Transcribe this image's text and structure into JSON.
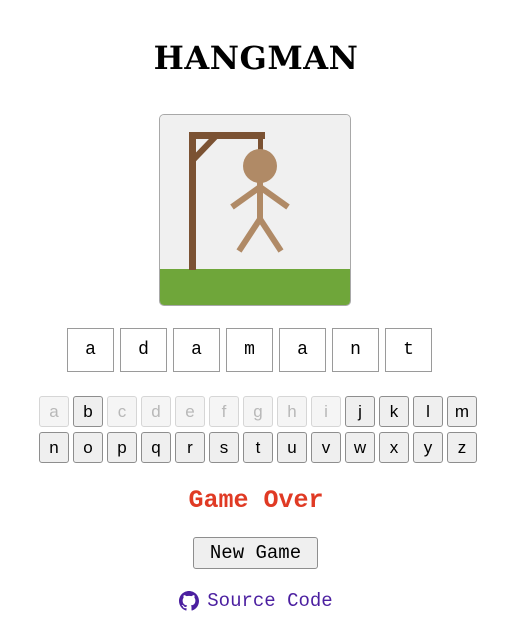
{
  "title": "HANGMAN",
  "word_letters": [
    "a",
    "d",
    "a",
    "m",
    "a",
    "n",
    "t"
  ],
  "keyboard": {
    "row1": [
      {
        "letter": "a",
        "used": true
      },
      {
        "letter": "b",
        "used": false
      },
      {
        "letter": "c",
        "used": true
      },
      {
        "letter": "d",
        "used": true
      },
      {
        "letter": "e",
        "used": true
      },
      {
        "letter": "f",
        "used": true
      },
      {
        "letter": "g",
        "used": true
      },
      {
        "letter": "h",
        "used": true
      },
      {
        "letter": "i",
        "used": true
      },
      {
        "letter": "j",
        "used": false
      },
      {
        "letter": "k",
        "used": false
      },
      {
        "letter": "l",
        "used": false
      },
      {
        "letter": "m",
        "used": false
      }
    ],
    "row2": [
      {
        "letter": "n",
        "used": false
      },
      {
        "letter": "o",
        "used": false
      },
      {
        "letter": "p",
        "used": false
      },
      {
        "letter": "q",
        "used": false
      },
      {
        "letter": "r",
        "used": false
      },
      {
        "letter": "s",
        "used": false
      },
      {
        "letter": "t",
        "used": false
      },
      {
        "letter": "u",
        "used": false
      },
      {
        "letter": "v",
        "used": false
      },
      {
        "letter": "w",
        "used": false
      },
      {
        "letter": "x",
        "used": false
      },
      {
        "letter": "y",
        "used": false
      },
      {
        "letter": "z",
        "used": false
      }
    ]
  },
  "status": {
    "text": "Game Over",
    "color": "#e03a24"
  },
  "new_game_label": "New Game",
  "source_link": {
    "label": "Source Code",
    "icon": "github-icon",
    "color": "#4b1fa0"
  },
  "colors": {
    "gallows": "#7b5233",
    "figure": "#b08a66",
    "grass": "#6fa63a",
    "backdrop": "#f0f0f0"
  }
}
